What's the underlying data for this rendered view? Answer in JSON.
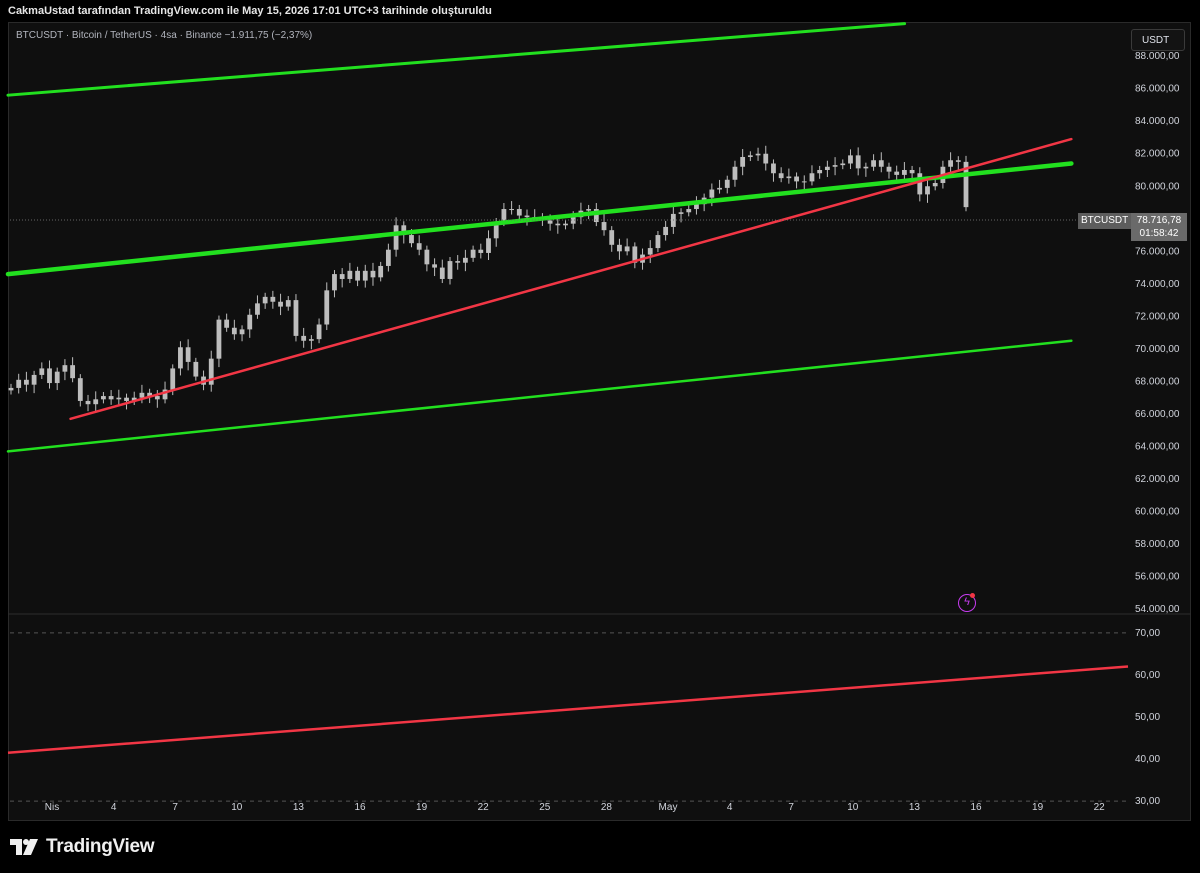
{
  "header": {
    "title": "CakmaUstad tarafından TradingView.com ile May 15, 2026 17:01 UTC+3 tarihinde oluşturuldu"
  },
  "symbol_info": "BTCUSDT · Bitcoin / TetherUS · 4sa · Binance  −1.911,75 (−2,37%)",
  "currency_button": "USDT",
  "last_price": {
    "symbol": "BTCUSDT",
    "price": "78.716,78",
    "countdown": "01:58:42",
    "value": 78716.78
  },
  "brand": {
    "name": "TradingView"
  },
  "colors": {
    "green_line": "#22e01f",
    "red_line": "#f23645",
    "candle": "#bdbdbd",
    "background": "#0f0f0f"
  },
  "icons": [
    "tradingview-logo-icon",
    "lightning-icon"
  ],
  "chart_data": [
    {
      "type": "line",
      "title": "",
      "xlabel": "",
      "ylabel": "",
      "x_ticks": [
        "Nis",
        "4",
        "7",
        "10",
        "13",
        "16",
        "19",
        "22",
        "25",
        "28",
        "May",
        "4",
        "7",
        "10",
        "13",
        "16",
        "19",
        "22"
      ],
      "y_ticks": [
        "88.000,00",
        "86.000,00",
        "84.000,00",
        "82.000,00",
        "80.000,00",
        "78.000,00",
        "76.000,00",
        "74.000,00",
        "72.000,00",
        "70.000,00",
        "68.000,00",
        "66.000,00",
        "64.000,00",
        "62.000,00",
        "60.000,00",
        "58.000,00",
        "56.000,00",
        "54.000,00"
      ],
      "ylim": [
        53700,
        90100
      ],
      "grid": false,
      "series": [
        {
          "values_close": [
            67600,
            68100,
            67800,
            68400,
            68800,
            67900,
            68600,
            69000,
            68200,
            66800,
            66600,
            66900,
            67100,
            66900,
            67000,
            66800,
            67000,
            67300,
            67100,
            66900,
            67500,
            68800,
            70100,
            69200,
            68300,
            67800,
            69400,
            71800,
            71300,
            70900,
            71200,
            72100,
            72800,
            73200,
            72900,
            72600,
            73000,
            70800,
            70500,
            70600,
            71500,
            73600,
            74600,
            74300,
            74800,
            74200,
            74800,
            74400,
            75100,
            76100,
            77600,
            77000,
            76500,
            76100,
            75200,
            75000,
            74300,
            75400,
            75300,
            75600,
            76100,
            75900,
            76800,
            77800,
            78600,
            78600,
            78200,
            78100,
            78100,
            77900,
            77700,
            77600,
            77700,
            78100,
            78500,
            78600,
            77800,
            77300,
            76400,
            76000,
            76300,
            75300,
            75800,
            76200,
            77000,
            77500,
            78300,
            78400,
            78600,
            78900,
            79300,
            79800,
            79900,
            80400,
            81200,
            81800,
            81900,
            82000,
            81400,
            80800,
            80500,
            80600,
            80300,
            80300,
            80800,
            81000,
            81200,
            81300,
            81400,
            81900,
            81100,
            81200,
            81600,
            81200,
            80900,
            80700,
            81000,
            80800,
            79500,
            80000,
            80200,
            81200,
            81600,
            81500,
            78716.78
          ]
        }
      ],
      "trendlines": [
        {
          "name": "upper-channel",
          "color": "#22e01f",
          "from": [
            "2026-03-31",
            85600
          ],
          "to": [
            "2026-05-13",
            90000
          ]
        },
        {
          "name": "middle-channel",
          "color": "#22e01f",
          "from": [
            "2026-03-31",
            74600
          ],
          "to": [
            "2026-05-21",
            81400
          ]
        },
        {
          "name": "lower-channel",
          "color": "#22e01f",
          "from": [
            "2026-03-31",
            63700
          ],
          "to": [
            "2026-05-21",
            70500
          ]
        },
        {
          "name": "support-trendline",
          "color": "#f23645",
          "from": [
            "2026-04-03",
            65700
          ],
          "to": [
            "2026-05-21",
            82900
          ]
        }
      ]
    },
    {
      "type": "line",
      "title": "",
      "y_ticks": [
        "70,00",
        "60,00",
        "50,00",
        "40,00",
        "30,00"
      ],
      "ylim": [
        25.5,
        74.5
      ],
      "levels": [
        70,
        30
      ],
      "series": [
        {
          "values": [
            41.5,
            62
          ]
        }
      ]
    }
  ]
}
